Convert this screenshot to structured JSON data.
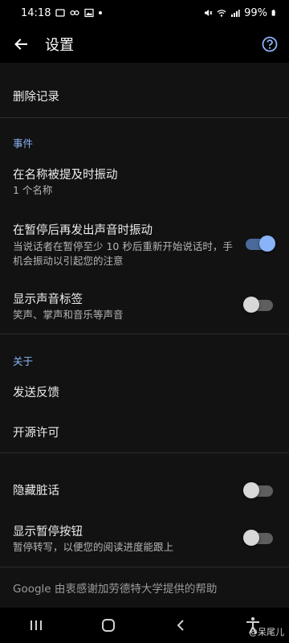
{
  "status_bar": {
    "time": "14:18",
    "battery": "99%"
  },
  "app_bar": {
    "title": "设置"
  },
  "items": {
    "delete_history": {
      "title": "删除记录"
    },
    "section_events": "事件",
    "vibrate_on_name": {
      "title": "在名称被提及时振动",
      "subtitle": "1 个名称"
    },
    "vibrate_on_resume": {
      "title": "在暂停后再发出声音时振动",
      "subtitle": "当说话者在暂停至少 10 秒后重新开始说话时，手机会振动以引起您的注意",
      "enabled": true
    },
    "sound_labels": {
      "title": "显示声音标签",
      "subtitle": "笑声、掌声和音乐等声音",
      "enabled": false
    },
    "section_about": "关于",
    "send_feedback": {
      "title": "发送反馈"
    },
    "open_source": {
      "title": "开源许可"
    },
    "hide_profanity": {
      "title": "隐藏脏话",
      "enabled": false
    },
    "show_pause_button": {
      "title": "显示暂停按钮",
      "subtitle": "暂停转写，以便您的阅读进度能跟上",
      "enabled": false
    },
    "footer": "Google 由衷感谢加劳德特大学提供的帮助"
  },
  "watermark": "@呆尾儿",
  "colors": {
    "accent": "#8ab4f8",
    "background": "#121212",
    "bar": "#000000"
  }
}
